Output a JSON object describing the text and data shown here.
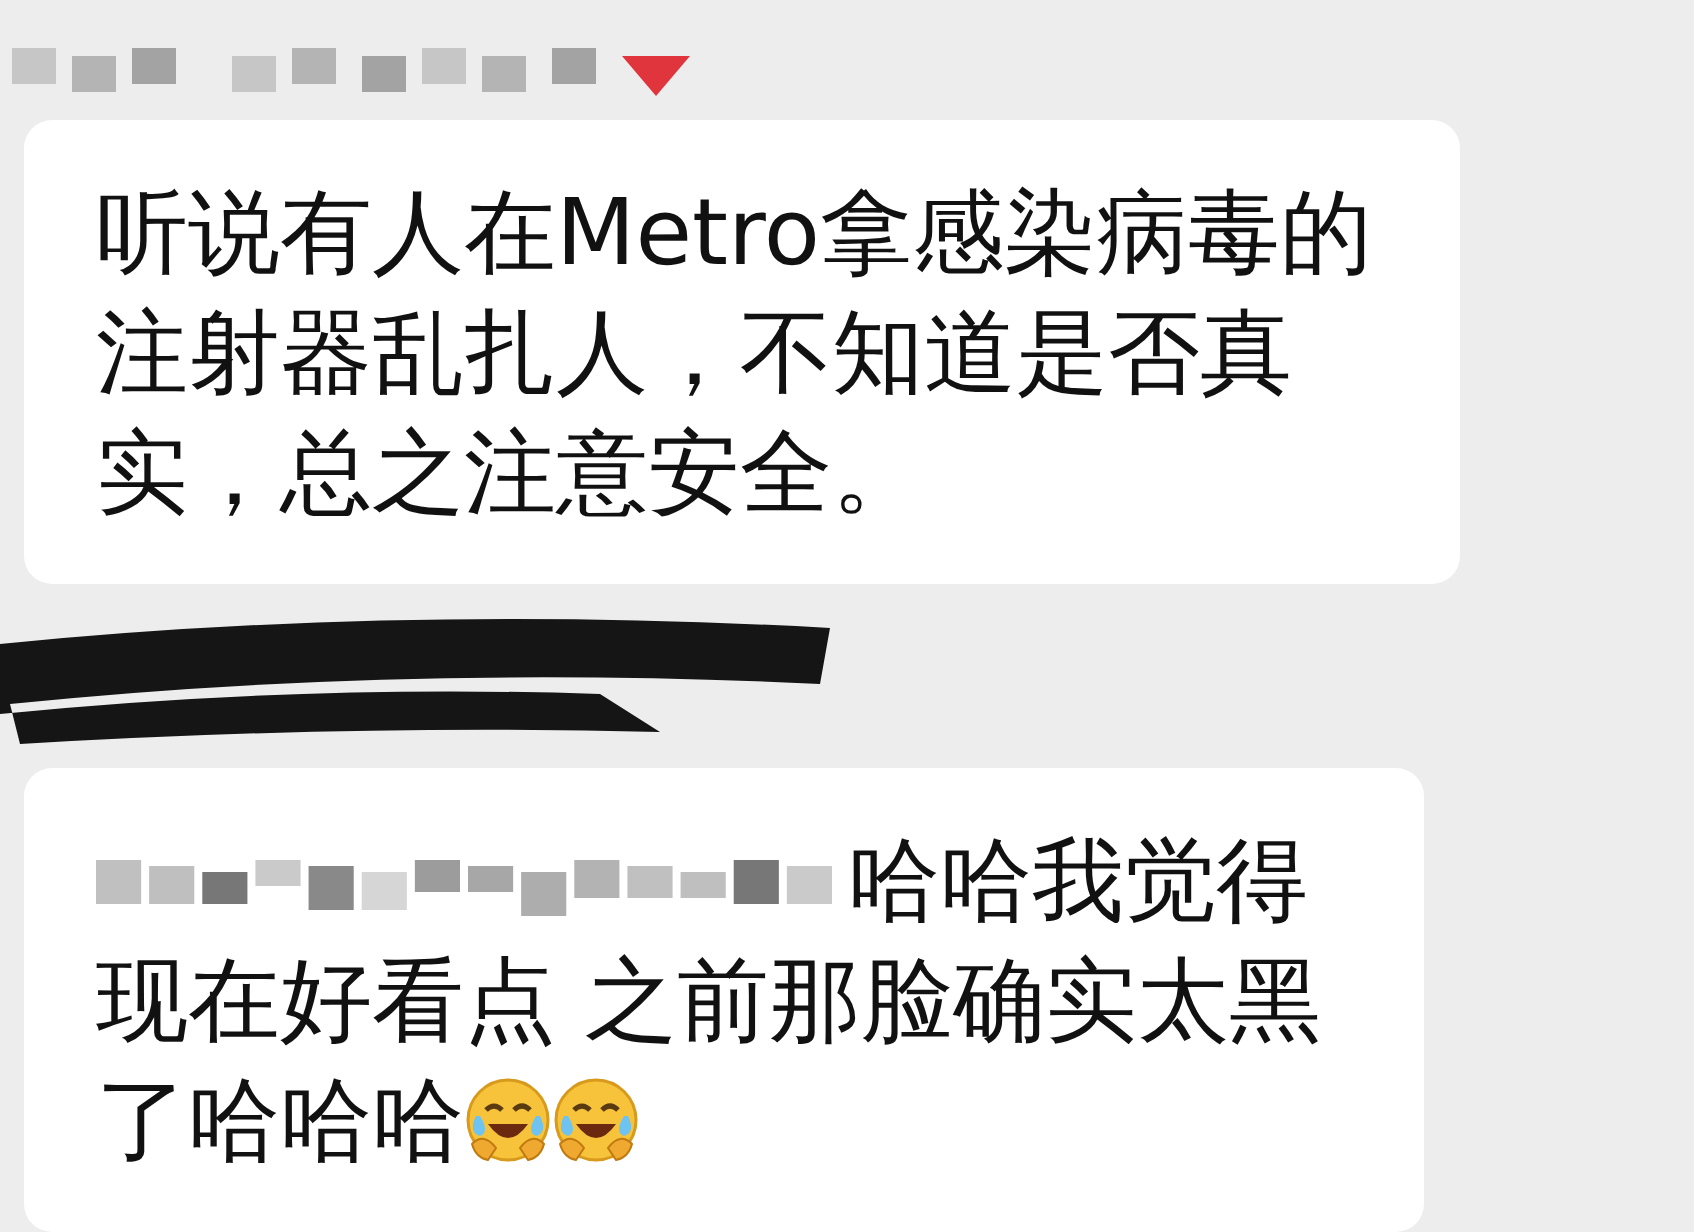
{
  "messages": [
    {
      "kind": "plain",
      "text": "听说有人在Metro拿感染病毒的注射器乱扎人，不知道是否真实，总之注意安全。"
    },
    {
      "kind": "mention",
      "text": "哈哈我觉得现在好看点 之前那脸确实太黑了哈哈哈",
      "emoji": [
        {
          "kind": "laugh-cry"
        },
        {
          "kind": "laugh-cry"
        }
      ]
    }
  ]
}
